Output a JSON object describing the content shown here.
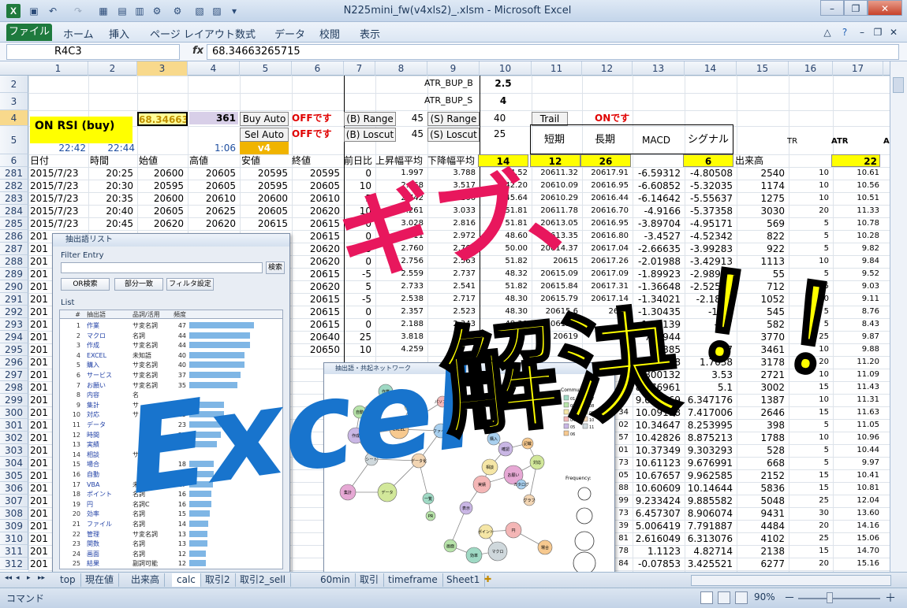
{
  "window": {
    "title": "N225mini_fw(v4xls2)_.xlsm  -  Microsoft Excel",
    "app_icon": "X",
    "min_label": "–",
    "max_label": "❐",
    "close_label": "✕"
  },
  "ribbon": {
    "file": "ファイル",
    "tabs": [
      "ホーム",
      "挿入",
      "ページ レイアウト",
      "数式",
      "データ",
      "校閲",
      "表示"
    ]
  },
  "formula_bar": {
    "name_box": "R4C3",
    "fx": "fx",
    "formula": "68.34663265715"
  },
  "columns": [
    "1",
    "2",
    "3",
    "4",
    "5",
    "6",
    "7",
    "8",
    "9",
    "10",
    "11",
    "12",
    "13",
    "14",
    "15",
    "16",
    "17"
  ],
  "header_rows": {
    "r2": {
      "num": "2",
      "atr_bup_b": "ATR_BUP_B",
      "atr_bup_b_val": "2.5"
    },
    "r3": {
      "num": "3",
      "atr_bup_s": "ATR_BUP_S",
      "atr_bup_s_val": "4"
    },
    "r4": {
      "num": "4",
      "rsi_label": "ON RSI (buy)",
      "c3": "68.34663",
      "c4": "361",
      "buy_auto": "Buy Auto",
      "off1": "OFFです",
      "b_range": "(B) Range",
      "b_range_val": "45",
      "s_range": "(S) Range",
      "s_range_val": "40",
      "trail": "Trail",
      "on_label": "ONです"
    },
    "r5": {
      "num": "5",
      "t1": "22:42",
      "t2": "22:44",
      "t3": "1:06",
      "sel_auto": "Sel Auto",
      "v4": "v4",
      "off2": "OFFです",
      "b_loscut": "(B) Loscut",
      "b_loscut_val": "45",
      "s_loscut": "(S) Loscut",
      "s_loscut_val": "25",
      "tanki": "短期",
      "chouki": "長期",
      "macd": "MACD",
      "signal": "シグナル",
      "tr": "TR",
      "atr": "ATR",
      "a_cut": "A"
    },
    "r6": {
      "num": "6",
      "date": "日付",
      "time": "時間",
      "open": "始値",
      "high": "高値",
      "low": "安値",
      "close": "終値",
      "diff": "前日比",
      "up_avg": "上昇幅平均",
      "down_avg": "下降幅平均",
      "c10": "14",
      "c11": "12",
      "c12": "26",
      "c14": "6",
      "volume": "出来高",
      "c17": "22"
    }
  },
  "rows": [
    {
      "n": "281",
      "date": "2015/7/23",
      "time": "20:25",
      "o": "20600",
      "h": "20605",
      "l": "20595",
      "c": "20595",
      "d": "0",
      "up": "1.997",
      "dn": "3.788",
      "rsi": "34.52",
      "s": "20611.32",
      "lg": "20617.91",
      "macd": "-6.59312",
      "sig": "-4.80508",
      "vol": "2540",
      "tr": "10",
      "atr": "10.61"
    },
    {
      "n": "282",
      "date": "2015/7/23",
      "time": "20:30",
      "o": "20595",
      "h": "20605",
      "l": "20595",
      "c": "20605",
      "d": "10",
      "up": "2.568",
      "dn": "3.517",
      "rsi": "42.20",
      "s": "20610.09",
      "lg": "20616.95",
      "macd": "-6.60852",
      "sig": "-5.32035",
      "vol": "1174",
      "tr": "10",
      "atr": "10.56"
    },
    {
      "n": "283",
      "date": "2015/7/23",
      "time": "20:35",
      "o": "20600",
      "h": "20610",
      "l": "20600",
      "c": "20610",
      "d": "5",
      "up": "2.742",
      "dn": "3.266",
      "rsi": "45.64",
      "s": "20610.29",
      "lg": "20616.44",
      "macd": "-6.14642",
      "sig": "-5.55637",
      "vol": "1275",
      "tr": "10",
      "atr": "10.51"
    },
    {
      "n": "284",
      "date": "2015/7/23",
      "time": "20:40",
      "o": "20605",
      "h": "20625",
      "l": "20605",
      "c": "20620",
      "d": "10",
      "up": "3.261",
      "dn": "3.033",
      "rsi": "51.81",
      "s": "20611.78",
      "lg": "20616.70",
      "macd": "-4.9166",
      "sig": "-5.37358",
      "vol": "3030",
      "tr": "20",
      "atr": "11.33"
    },
    {
      "n": "285",
      "date": "2015/7/23",
      "time": "20:45",
      "o": "20620",
      "h": "20620",
      "l": "20615",
      "c": "20615",
      "d": "0",
      "up": "3.028",
      "dn": "2.816",
      "rsi": "51.81",
      "s": "20613.05",
      "lg": "20616.95",
      "macd": "-3.89704",
      "sig": "-4.95171",
      "vol": "569",
      "tr": "5",
      "atr": "10.78"
    },
    {
      "n": "286",
      "date": "201",
      "time": "",
      "o": "",
      "h": "",
      "l": "",
      "c": "20615",
      "d": "0",
      "up": "2.811",
      "dn": "2.972",
      "rsi": "48.60",
      "s": "20613.35",
      "lg": "20616.80",
      "macd": "-3.4527",
      "sig": "-4.52342",
      "vol": "822",
      "tr": "5",
      "atr": "10.28"
    },
    {
      "n": "287",
      "date": "201",
      "time": "",
      "o": "",
      "h": "",
      "l": "",
      "c": "20620",
      "d": "5",
      "up": "2.760",
      "dn": "2.760",
      "rsi": "50.00",
      "s": "20614.37",
      "lg": "20617.04",
      "macd": "-2.66635",
      "sig": "-3.99283",
      "vol": "922",
      "tr": "5",
      "atr": "9.82"
    },
    {
      "n": "288",
      "date": "201",
      "time": "",
      "o": "",
      "h": "",
      "l": "",
      "c": "20620",
      "d": "0",
      "up": "2.756",
      "dn": "2.563",
      "rsi": "51.82",
      "s": "20615",
      "lg": "20617.26",
      "macd": "-2.01988",
      "sig": "-3.42913",
      "vol": "1113",
      "tr": "10",
      "atr": "9.84"
    },
    {
      "n": "289",
      "date": "201",
      "time": "",
      "o": "",
      "h": "",
      "l": "",
      "c": "20615",
      "d": "-5",
      "up": "2.559",
      "dn": "2.737",
      "rsi": "48.32",
      "s": "20615.09",
      "lg": "20617.09",
      "macd": "-1.89923",
      "sig": "-2.98916",
      "vol": "55",
      "tr": "5",
      "atr": "9.52"
    },
    {
      "n": "290",
      "date": "201",
      "time": "",
      "o": "",
      "h": "",
      "l": "",
      "c": "20620",
      "d": "5",
      "up": "2.733",
      "dn": "2.541",
      "rsi": "51.82",
      "s": "20615.84",
      "lg": "20617.31",
      "macd": "-1.36648",
      "sig": "-2.52554",
      "vol": "712",
      "tr": "5",
      "atr": "9.03"
    },
    {
      "n": "291",
      "date": "201",
      "time": "",
      "o": "",
      "h": "",
      "l": "",
      "c": "20615",
      "d": "-5",
      "up": "2.538",
      "dn": "2.717",
      "rsi": "48.30",
      "s": "20615.79",
      "lg": "20617.14",
      "macd": "-1.34021",
      "sig": "-2.1868",
      "vol": "1052",
      "tr": "10",
      "atr": "9.11"
    },
    {
      "n": "292",
      "date": "201",
      "time": "",
      "o": "",
      "h": "",
      "l": "",
      "c": "20615",
      "d": "0",
      "up": "2.357",
      "dn": "2.523",
      "rsi": "48.30",
      "s": "20615.6",
      "lg": "2617",
      "macd": "-1.30435",
      "sig": "-1.99",
      "vol": "545",
      "tr": "5",
      "atr": "8.76"
    },
    {
      "n": "293",
      "date": "201",
      "time": "",
      "o": "",
      "h": "",
      "l": "",
      "c": "20615",
      "d": "0",
      "up": "2.188",
      "dn": "2.343",
      "rsi": "48.30",
      "s": "20615.5",
      "lg": "",
      "macd": "-1.26139",
      "sig": "-1.7",
      "vol": "582",
      "tr": "5",
      "atr": "8.43"
    },
    {
      "n": "294",
      "date": "201",
      "time": "",
      "o": "",
      "h": "",
      "l": "",
      "c": "20640",
      "d": "25",
      "up": "3.818",
      "dn": "",
      "rsi": "",
      "s": "20619",
      "lg": "",
      "macd": "780944",
      "sig": "",
      "vol": "3770",
      "tr": "25",
      "atr": "9.87"
    },
    {
      "n": "295",
      "date": "201",
      "time": "",
      "o": "",
      "h": "",
      "l": "",
      "c": "20650",
      "d": "10",
      "up": "4.259",
      "dn": "",
      "rsi": "",
      "s": "",
      "lg": "",
      "macd": "69885",
      "sig": "0.17",
      "vol": "3461",
      "tr": "10",
      "atr": "9.88"
    },
    {
      "n": "296",
      "date": "201",
      "time": "",
      "o": "",
      "h": "",
      "l": "",
      "c": "",
      "d": "",
      "up": "",
      "dn": "",
      "rsi": "",
      "s": "",
      "lg": "",
      "macd": "03158",
      "sig": "1.7638",
      "vol": "3178",
      "tr": "20",
      "atr": "11.20"
    },
    {
      "n": "297",
      "date": "201",
      "time": "",
      "o": "",
      "h": "",
      "l": "",
      "c": "",
      "d": "",
      "up": "",
      "dn": "",
      "rsi": "",
      "s": "",
      "lg": "",
      "macd": "7.800132",
      "sig": "3.53",
      "vol": "2721",
      "tr": "10",
      "atr": "11.09"
    },
    {
      "n": "298",
      "date": "201",
      "time": "",
      "o": "",
      "h": "",
      "l": "",
      "c": "",
      "d": "",
      "up": "",
      "dn": "",
      "rsi": "",
      "s": "",
      "lg": "",
      "macd": "8.876961",
      "sig": "5.1",
      "vol": "3002",
      "tr": "15",
      "atr": "11.43"
    },
    {
      "n": "299",
      "date": "201",
      "time": "",
      "o": "",
      "h": "",
      "l": "",
      "c": "",
      "d": "",
      "up": "",
      "dn": "",
      "rsi": "",
      "s": "",
      "lg": "",
      "macd": "9.619469",
      "sig": "6.347176",
      "vol": "1387",
      "tr": "10",
      "atr": "11.31"
    },
    {
      "n": "300",
      "date": "201",
      "time": "",
      "o": "",
      "h": "",
      "l": "",
      "c": "",
      "d": "",
      "up": "",
      "dn": "",
      "rsi": "",
      "s": "",
      "lg": "34",
      "macd": "10.09158",
      "sig": "7.417006",
      "vol": "2646",
      "tr": "15",
      "atr": "11.63"
    },
    {
      "n": "301",
      "date": "201",
      "time": "",
      "o": "",
      "h": "",
      "l": "",
      "c": "",
      "d": "",
      "up": "",
      "dn": "",
      "rsi": "",
      "s": "",
      "lg": "02",
      "macd": "10.34647",
      "sig": "8.253995",
      "vol": "398",
      "tr": "5",
      "atr": "11.05"
    },
    {
      "n": "302",
      "date": "201",
      "time": "",
      "o": "",
      "h": "",
      "l": "",
      "c": "",
      "d": "",
      "up": "",
      "dn": "",
      "rsi": "",
      "s": "",
      "lg": "57",
      "macd": "10.42826",
      "sig": "8.875213",
      "vol": "1788",
      "tr": "10",
      "atr": "10.96"
    },
    {
      "n": "303",
      "date": "201",
      "time": "",
      "o": "",
      "h": "",
      "l": "",
      "c": "",
      "d": "",
      "up": "",
      "dn": "",
      "rsi": "",
      "s": "",
      "lg": "01",
      "macd": "10.37349",
      "sig": "9.303293",
      "vol": "528",
      "tr": "5",
      "atr": "10.44"
    },
    {
      "n": "304",
      "date": "201",
      "time": "",
      "o": "",
      "h": "",
      "l": "",
      "c": "",
      "d": "",
      "up": "",
      "dn": "",
      "rsi": "",
      "s": "",
      "lg": "73",
      "macd": "10.61123",
      "sig": "9.676991",
      "vol": "668",
      "tr": "5",
      "atr": "9.97"
    },
    {
      "n": "305",
      "date": "201",
      "time": "",
      "o": "",
      "h": "",
      "l": "",
      "c": "",
      "d": "",
      "up": "",
      "dn": "",
      "rsi": "",
      "s": "",
      "lg": "05",
      "macd": "10.67657",
      "sig": "9.962585",
      "vol": "2152",
      "tr": "15",
      "atr": "10.41"
    },
    {
      "n": "306",
      "date": "201",
      "time": "",
      "o": "",
      "h": "",
      "l": "",
      "c": "",
      "d": "",
      "up": "",
      "dn": "",
      "rsi": "",
      "s": "",
      "lg": "88",
      "macd": "10.60609",
      "sig": "10.14644",
      "vol": "5836",
      "tr": "15",
      "atr": "10.81"
    },
    {
      "n": "307",
      "date": "201",
      "time": "",
      "o": "",
      "h": "",
      "l": "",
      "c": "",
      "d": "",
      "up": "",
      "dn": "",
      "rsi": "",
      "s": "",
      "lg": "99",
      "macd": "9.233424",
      "sig": "9.885582",
      "vol": "5048",
      "tr": "25",
      "atr": "12.04"
    },
    {
      "n": "308",
      "date": "201",
      "time": "",
      "o": "",
      "h": "",
      "l": "",
      "c": "",
      "d": "",
      "up": "",
      "dn": "",
      "rsi": "",
      "s": "",
      "lg": "73",
      "macd": "6.457307",
      "sig": "8.906074",
      "vol": "9431",
      "tr": "30",
      "atr": "13.60"
    },
    {
      "n": "309",
      "date": "201",
      "time": "",
      "o": "",
      "h": "",
      "l": "",
      "c": "",
      "d": "",
      "up": "",
      "dn": "",
      "rsi": "",
      "s": "",
      "lg": "39",
      "macd": "5.006419",
      "sig": "7.791887",
      "vol": "4484",
      "tr": "20",
      "atr": "14.16"
    },
    {
      "n": "310",
      "date": "201",
      "time": "",
      "o": "",
      "h": "",
      "l": "",
      "c": "",
      "d": "",
      "up": "",
      "dn": "",
      "rsi": "",
      "s": "",
      "lg": "81",
      "macd": "2.616049",
      "sig": "6.313076",
      "vol": "4102",
      "tr": "25",
      "atr": "15.06"
    },
    {
      "n": "311",
      "date": "201",
      "time": "",
      "o": "",
      "h": "",
      "l": "",
      "c": "",
      "d": "",
      "up": "",
      "dn": "",
      "rsi": "",
      "s": "",
      "lg": "78",
      "macd": "1.1123",
      "sig": "4.82714",
      "vol": "2138",
      "tr": "15",
      "atr": "14.70"
    },
    {
      "n": "312",
      "date": "201",
      "time": "",
      "o": "",
      "h": "",
      "l": "",
      "c": "",
      "d": "",
      "up": "",
      "dn": "",
      "rsi": "",
      "s": "",
      "lg": "84",
      "macd": "-0.07853",
      "sig": "3.425521",
      "vol": "6277",
      "tr": "20",
      "atr": "15.16"
    }
  ],
  "list_window": {
    "title": "抽出語リスト",
    "filter_group": "Filter Entry",
    "search_btn": "検索",
    "or_btn": "OR検索",
    "match_btn": "部分一致",
    "filter_btn": "フィルタ設定",
    "list_group": "List",
    "headers": [
      "#",
      "抽出語",
      "品詞/活用",
      "頻度"
    ],
    "items": [
      {
        "n": "1",
        "w": "作業",
        "p": "サ変名詞",
        "f": "47"
      },
      {
        "n": "2",
        "w": "マクロ",
        "p": "名詞",
        "f": "44"
      },
      {
        "n": "3",
        "w": "作成",
        "p": "サ変名詞",
        "f": "44"
      },
      {
        "n": "4",
        "w": "EXCEL",
        "p": "未知語",
        "f": "40"
      },
      {
        "n": "5",
        "w": "購入",
        "p": "サ変名詞",
        "f": "40"
      },
      {
        "n": "6",
        "w": "サービス",
        "p": "サ変名詞",
        "f": "37"
      },
      {
        "n": "7",
        "w": "お願い",
        "p": "サ変名詞",
        "f": "35"
      },
      {
        "n": "8",
        "w": "内容",
        "p": "名",
        "f": ""
      },
      {
        "n": "9",
        "w": "集計",
        "p": "サ",
        "f": "25"
      },
      {
        "n": "10",
        "w": "対応",
        "p": "サ",
        "f": "25"
      },
      {
        "n": "11",
        "w": "データ",
        "p": "",
        "f": "23"
      },
      {
        "n": "12",
        "w": "時間",
        "p": "",
        "f": "23"
      },
      {
        "n": "13",
        "w": "実績",
        "p": "",
        "f": "20"
      },
      {
        "n": "14",
        "w": "相談",
        "p": "サ",
        "f": ""
      },
      {
        "n": "15",
        "w": "場合",
        "p": "",
        "f": "18"
      },
      {
        "n": "16",
        "w": "自動",
        "p": "",
        "f": "18"
      },
      {
        "n": "17",
        "w": "VBA",
        "p": "未知語",
        "f": "17"
      },
      {
        "n": "18",
        "w": "ポイント",
        "p": "名詞",
        "f": "16"
      },
      {
        "n": "19",
        "w": "円",
        "p": "名詞C",
        "f": "16"
      },
      {
        "n": "20",
        "w": "効率",
        "p": "名詞",
        "f": "15"
      },
      {
        "n": "21",
        "w": "ファイル",
        "p": "名詞",
        "f": "14"
      },
      {
        "n": "22",
        "w": "管理",
        "p": "サ変名詞",
        "f": "13"
      },
      {
        "n": "23",
        "w": "関数",
        "p": "名詞",
        "f": "13"
      },
      {
        "n": "24",
        "w": "画面",
        "p": "名詞",
        "f": "12"
      },
      {
        "n": "25",
        "w": "結果",
        "p": "副詞可能",
        "f": "12"
      }
    ]
  },
  "network_window": {
    "title": "抽出語・共起ネットワーク",
    "legend_community": "Community:",
    "legend_frequency": "Frequency:",
    "community_ids": [
      "01",
      "02",
      "03",
      "04",
      "05",
      "06",
      "07",
      "08",
      "09",
      "10",
      "11"
    ],
    "nodes": [
      "作業",
      "自動",
      "関数",
      "パソコン",
      "作成",
      "EXCEL",
      "ファイル",
      "集計",
      "データ",
      "データ化",
      "シート",
      "一覧",
      "PR",
      "相談",
      "実績",
      "確認",
      "記載",
      "購入",
      "お願い",
      "対応",
      "グラフ",
      "マクロ",
      "効率",
      "画面",
      "ポイント",
      "円",
      "表示",
      "場合",
      "カタログ"
    ]
  },
  "overlay": {
    "gibu": "ギブ、",
    "excel": "Excel",
    "kaiketsu": "解決",
    "bang": "！！"
  },
  "sheet_tabs": [
    "top",
    "現在値",
    "出来高",
    "calc",
    "取引2",
    "取引2_sell",
    "60min",
    "取引",
    "timeframe",
    "Sheet1"
  ],
  "active_sheet": "calc",
  "status": {
    "mode": "コマンド",
    "zoom": "90%",
    "zoom_minus": "－",
    "zoom_plus": "＋"
  },
  "colors": {
    "yellow": "#ffff00",
    "rsi_bar": "#7fb6e5",
    "magenta": "#e8175d",
    "blue": "#1874cd"
  }
}
